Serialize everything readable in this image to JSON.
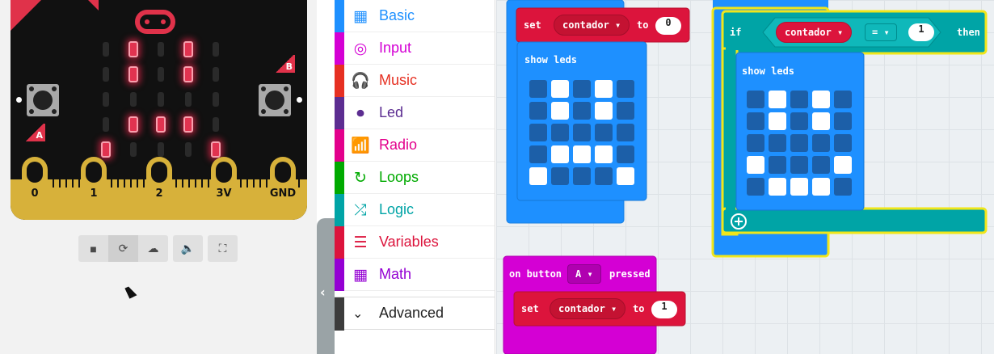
{
  "simulator": {
    "buttons": {
      "a_label": "A",
      "b_label": "B"
    },
    "pins": [
      "0",
      "1",
      "2",
      "3V",
      "GND"
    ],
    "leds_on": [
      [
        0,
        1,
        0,
        1,
        0
      ],
      [
        0,
        1,
        0,
        1,
        0
      ],
      [
        0,
        0,
        0,
        0,
        0
      ],
      [
        0,
        1,
        1,
        1,
        0
      ],
      [
        1,
        0,
        0,
        0,
        1
      ]
    ],
    "controls": [
      "stop-icon",
      "restart-icon",
      "slowmo-icon",
      "mute-icon",
      "fullscreen-icon"
    ]
  },
  "toolbox": {
    "categories": [
      {
        "label": "Basic",
        "color": "#1e90ff",
        "icon": "grid-icon"
      },
      {
        "label": "Input",
        "color": "#d400d4",
        "icon": "target-icon"
      },
      {
        "label": "Music",
        "color": "#e63022",
        "icon": "headphones-icon"
      },
      {
        "label": "Led",
        "color": "#5c2d91",
        "icon": "toggle-icon"
      },
      {
        "label": "Radio",
        "color": "#e3008c",
        "icon": "signal-icon"
      },
      {
        "label": "Loops",
        "color": "#00aa00",
        "icon": "loop-icon"
      },
      {
        "label": "Logic",
        "color": "#00a4a6",
        "icon": "shuffle-icon"
      },
      {
        "label": "Variables",
        "color": "#dc143c",
        "icon": "lines-icon"
      },
      {
        "label": "Math",
        "color": "#9400d3",
        "icon": "calculator-icon"
      }
    ],
    "advanced_label": "Advanced"
  },
  "workspace": {
    "set1": {
      "set": "set",
      "var": "contador",
      "to": "to",
      "value": "0"
    },
    "show1": {
      "label": "show leds",
      "grid": [
        [
          0,
          1,
          0,
          1,
          0
        ],
        [
          0,
          1,
          0,
          1,
          0
        ],
        [
          0,
          0,
          0,
          0,
          0
        ],
        [
          0,
          1,
          1,
          1,
          0
        ],
        [
          1,
          0,
          0,
          0,
          1
        ]
      ]
    },
    "if_block": {
      "if": "if",
      "var": "contador",
      "op": "=",
      "value": "1",
      "then": "then"
    },
    "show2": {
      "label": "show leds",
      "grid": [
        [
          0,
          1,
          0,
          1,
          0
        ],
        [
          0,
          1,
          0,
          1,
          0
        ],
        [
          0,
          0,
          0,
          0,
          0
        ],
        [
          1,
          0,
          0,
          0,
          1
        ],
        [
          0,
          1,
          1,
          1,
          0
        ]
      ]
    },
    "on_button": {
      "on": "on button",
      "button": "A",
      "pressed": "pressed"
    },
    "set2": {
      "set": "set",
      "var": "contador",
      "to": "to",
      "value": "1"
    }
  }
}
